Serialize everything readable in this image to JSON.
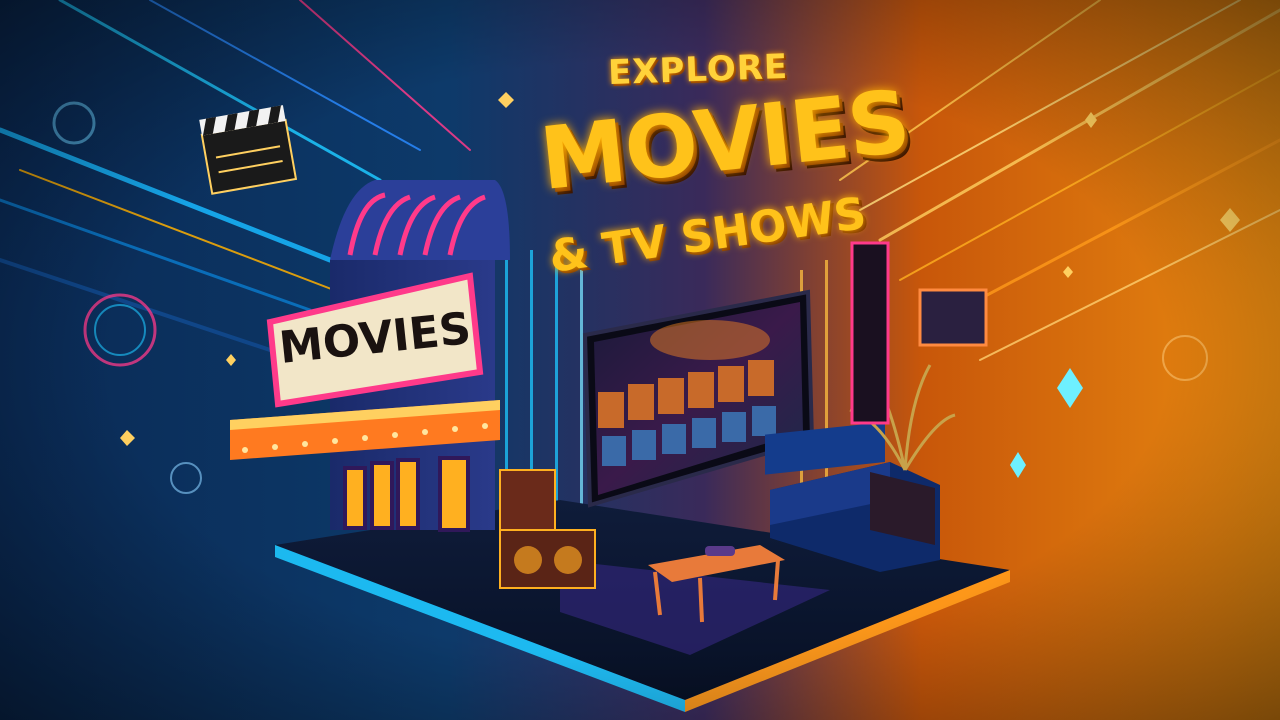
{
  "headline": {
    "line1": "EXPLORE",
    "line2": "MOVIES",
    "line3": "& TV SHOWS"
  },
  "marquee": {
    "sign_text": "MOVIES"
  },
  "colors": {
    "left_glow": "#1ec8ff",
    "right_glow": "#ff9a1a",
    "headline_gold": "#ffc21a",
    "neon_pink": "#ff3a8a"
  },
  "icons": [
    "clapperboard-icon",
    "sparkle-icon",
    "tv-screen-icon",
    "sofa-icon"
  ]
}
